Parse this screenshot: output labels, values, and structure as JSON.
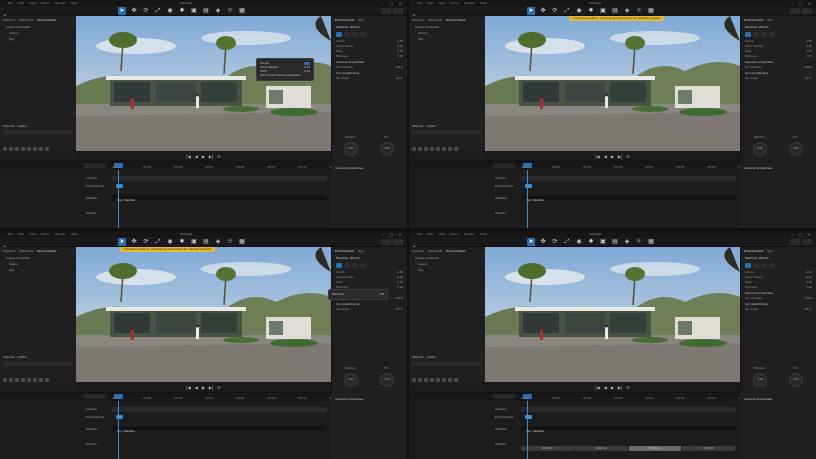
{
  "app": {
    "title": "Vantage"
  },
  "menu": [
    "File",
    "Edit",
    "View",
    "Scene",
    "Render",
    "Help"
  ],
  "tools": [
    "select-icon",
    "move-icon",
    "rotate-icon",
    "scale-icon",
    "camera-icon",
    "light-icon",
    "render-icon",
    "image-icon",
    "cube-icon",
    "sun-icon",
    "grid-icon"
  ],
  "left_panel": {
    "tabs": [
      "Explorer",
      "Materials",
      "Environment"
    ],
    "items": [
      {
        "label": "Scene Contents"
      },
      {
        "label": "Scene"
      },
      {
        "label": "Sky"
      }
    ],
    "section2": "Objects",
    "section2b": "Lights"
  },
  "viewport": {
    "bottom_buttons": [
      "|◀",
      "◀",
      "▶",
      "▶|",
      "⟳"
    ]
  },
  "right_panel": {
    "tabs": [
      "Environment",
      "Sky"
    ],
    "section": "Weather effects",
    "rows": [
      {
        "label": "Clouds",
        "value": "0.50"
      },
      {
        "label": "Cloud density",
        "value": "0.45"
      },
      {
        "label": "Haze",
        "value": "0.12"
      },
      {
        "label": "Exposure",
        "value": "1.00"
      },
      {
        "label": "Sun intensity",
        "value": "100.0"
      },
      {
        "label": "Sun angle",
        "value": "45.0°"
      }
    ],
    "knob_labels": [
      "Rotation",
      "Tilt"
    ],
    "knob_values": [
      "0.00",
      "0.00"
    ],
    "section_general": "General properties",
    "section_sun": "Sun positioning",
    "tooltip_note": "Add current frame as keyframe"
  },
  "timeline": {
    "fps": "24/30 fps",
    "ruler": [
      "00:00",
      "00:05",
      "00:10",
      "00:15",
      "00:20",
      "00:25",
      "00:30",
      "00:35",
      "00:40"
    ],
    "tracks": [
      "Camera",
      "Environment",
      "Weather",
      "Objects"
    ],
    "clip_label": "Sky / Weather",
    "cam_clips": [
      "00:00:00",
      "00:04:12",
      "00:09:10",
      "00:14:02"
    ]
  },
  "banner": {
    "text": "Animation enabled – Keyframing mode active for selected property"
  },
  "properties_label": "General properties"
}
